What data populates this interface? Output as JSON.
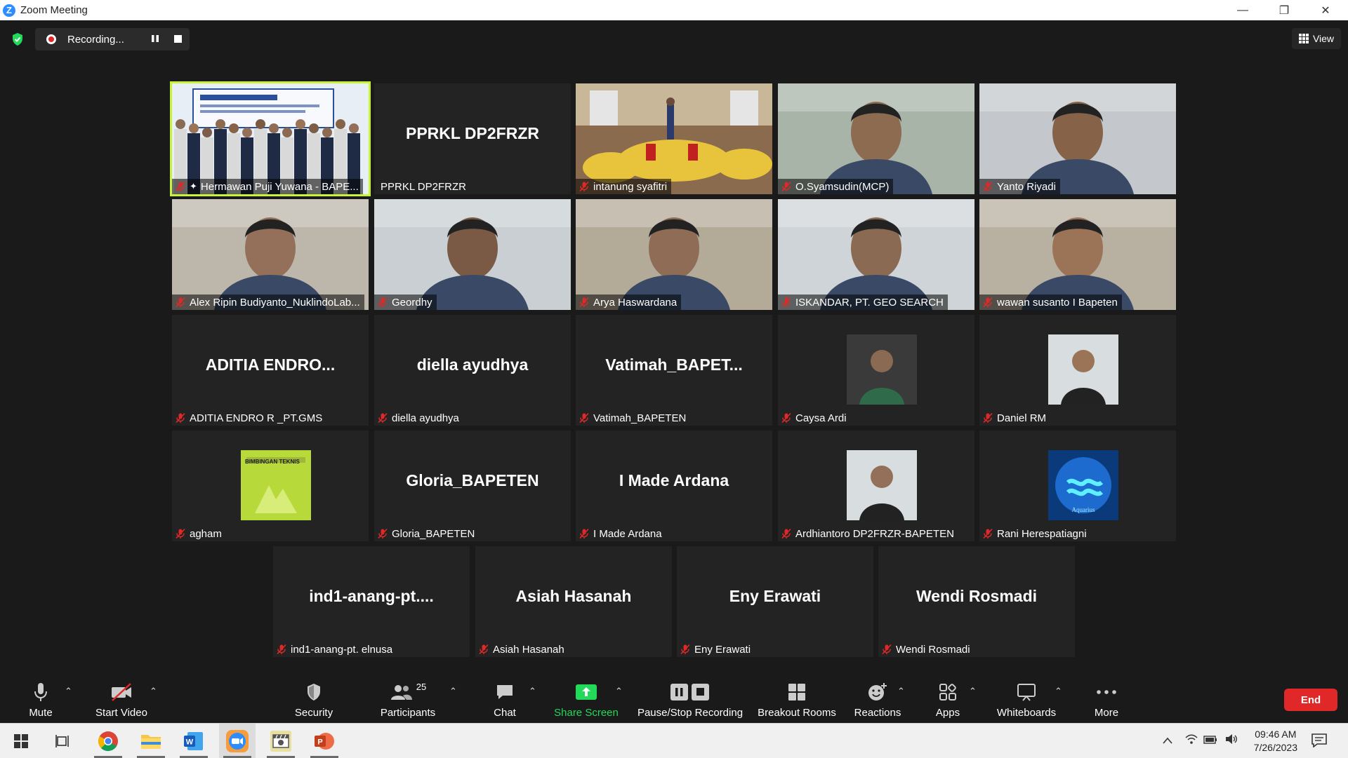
{
  "window": {
    "title": "Zoom Meeting",
    "minimize": "—",
    "restore": "❐",
    "close": "✕"
  },
  "recording": {
    "status": "Recording..."
  },
  "view_button": {
    "label": "View"
  },
  "colors": {
    "accent": "#2d8cff",
    "active_speaker": "#c9f33a",
    "end": "#e02828",
    "share": "#23d959",
    "mic_muted": "#e02828"
  },
  "tiles": [
    {
      "label": "Hermawan Puji Yuwana - BAPE...",
      "big": "",
      "type": "photo-group",
      "active": true,
      "pinned": true
    },
    {
      "label": "PPRKL DP2FRZR",
      "big": "PPRKL DP2FRZR",
      "type": "name",
      "muted": false
    },
    {
      "label": "intanung syafitri",
      "big": "",
      "type": "photo-room"
    },
    {
      "label": "O.Syamsudin(MCP)",
      "big": "",
      "type": "photo-face"
    },
    {
      "label": "Yanto Riyadi",
      "big": "",
      "type": "photo-face"
    },
    {
      "label": "Alex Ripin Budiyanto_NuklindoLab...",
      "big": "",
      "type": "photo-face"
    },
    {
      "label": "Geordhy",
      "big": "",
      "type": "photo-face"
    },
    {
      "label": "Arya Haswardana",
      "big": "",
      "type": "photo-face"
    },
    {
      "label": "ISKANDAR, PT. GEO SEARCH",
      "big": "",
      "type": "photo-face"
    },
    {
      "label": "wawan susanto I Bapeten",
      "big": "",
      "type": "photo-face"
    },
    {
      "label": "ADITIA ENDRO R _PT.GMS",
      "big": "ADITIA  ENDRO...",
      "type": "name"
    },
    {
      "label": "diella ayudhya",
      "big": "diella ayudhya",
      "type": "name"
    },
    {
      "label": "Vatimah_BAPETEN",
      "big": "Vatimah_BAPET...",
      "type": "name"
    },
    {
      "label": "Caysa Ardi",
      "big": "",
      "type": "avatar"
    },
    {
      "label": "Daniel RM",
      "big": "",
      "type": "avatar"
    },
    {
      "label": "agham",
      "big": "",
      "type": "avatar-book"
    },
    {
      "label": "Gloria_BAPETEN",
      "big": "Gloria_BAPETEN",
      "type": "name"
    },
    {
      "label": "I Made Ardana",
      "big": "I Made Ardana",
      "type": "name"
    },
    {
      "label": "Ardhiantoro DP2FRZR-BAPETEN",
      "big": "",
      "type": "avatar"
    },
    {
      "label": "Rani Herespatiagni",
      "big": "",
      "type": "avatar-aquarius"
    },
    {
      "label": "ind1-anang-pt. elnusa",
      "big": "ind1-anang-pt....",
      "type": "name"
    },
    {
      "label": "Asiah Hasanah",
      "big": "Asiah Hasanah",
      "type": "name"
    },
    {
      "label": "Eny Erawati",
      "big": "Eny Erawati",
      "type": "name"
    },
    {
      "label": "Wendi Rosmadi",
      "big": "Wendi Rosmadi",
      "type": "name"
    }
  ],
  "avatar_book_text": "BIMBINGAN TEKNIS",
  "avatar_aquarius_text": "Aquarius",
  "toolbar": {
    "mute": "Mute",
    "start_video": "Start Video",
    "security": "Security",
    "participants": "Participants",
    "participants_count": "25",
    "chat": "Chat",
    "share_screen": "Share Screen",
    "pause_stop_recording": "Pause/Stop Recording",
    "breakout_rooms": "Breakout Rooms",
    "reactions": "Reactions",
    "apps": "Apps",
    "whiteboards": "Whiteboards",
    "more": "More",
    "end": "End"
  },
  "taskbar": {
    "time": "09:46 AM",
    "date": "7/26/2023",
    "apps": [
      "start-icon",
      "task-view-icon",
      "chrome-icon",
      "file-explorer-icon",
      "word-icon",
      "zoom-icon",
      "photos-icon",
      "powerpoint-icon"
    ]
  }
}
